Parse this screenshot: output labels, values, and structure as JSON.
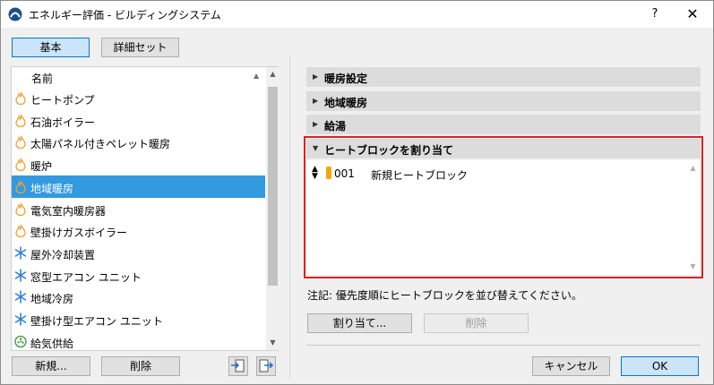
{
  "window": {
    "title": "エネルギー評価 - ビルディングシステム",
    "help_label": "?",
    "close_label": "✕"
  },
  "tabs": {
    "basic": "基本",
    "detail_set": "詳細セット"
  },
  "list": {
    "header": "名前",
    "items": [
      {
        "label": "ヒートポンプ",
        "icon": "flame-icon"
      },
      {
        "label": "石油ボイラー",
        "icon": "flame-icon"
      },
      {
        "label": "太陽パネル付きペレット暖房",
        "icon": "flame-icon"
      },
      {
        "label": "暖炉",
        "icon": "flame-icon"
      },
      {
        "label": "地域暖房",
        "icon": "flame-icon",
        "selected": true
      },
      {
        "label": "電気室内暖房器",
        "icon": "flame-icon"
      },
      {
        "label": "壁掛けガスボイラー",
        "icon": "flame-icon"
      },
      {
        "label": "屋外冷却装置",
        "icon": "snowflake-icon"
      },
      {
        "label": "窓型エアコン ユニット",
        "icon": "snowflake-icon"
      },
      {
        "label": "地域冷房",
        "icon": "snowflake-icon"
      },
      {
        "label": "壁掛け型エアコン ユニット",
        "icon": "snowflake-icon"
      },
      {
        "label": "給気供給",
        "icon": "fan-icon"
      }
    ],
    "new_label": "新規...",
    "delete_label": "削除"
  },
  "sections": {
    "heating": "暖房設定",
    "district_heating": "地域暖房",
    "hot_water": "給湯",
    "heat_block": "ヒートブロックを割り当て"
  },
  "heat_block": {
    "number": "001",
    "name": "新規ヒートブロック"
  },
  "note": "注記: 優先度順にヒートブロックを並び替えてください。",
  "assign_label": "割り当て...",
  "remove_label": "削除",
  "cancel_label": "キャンセル",
  "ok_label": "OK",
  "colors": {
    "selection": "#3399e0",
    "flame": "#f0a030",
    "snowflake": "#2a7fd4",
    "fan": "#3a9a3a",
    "highlight_frame": "#e02020",
    "heat_block_swatch": "#f0a800"
  }
}
